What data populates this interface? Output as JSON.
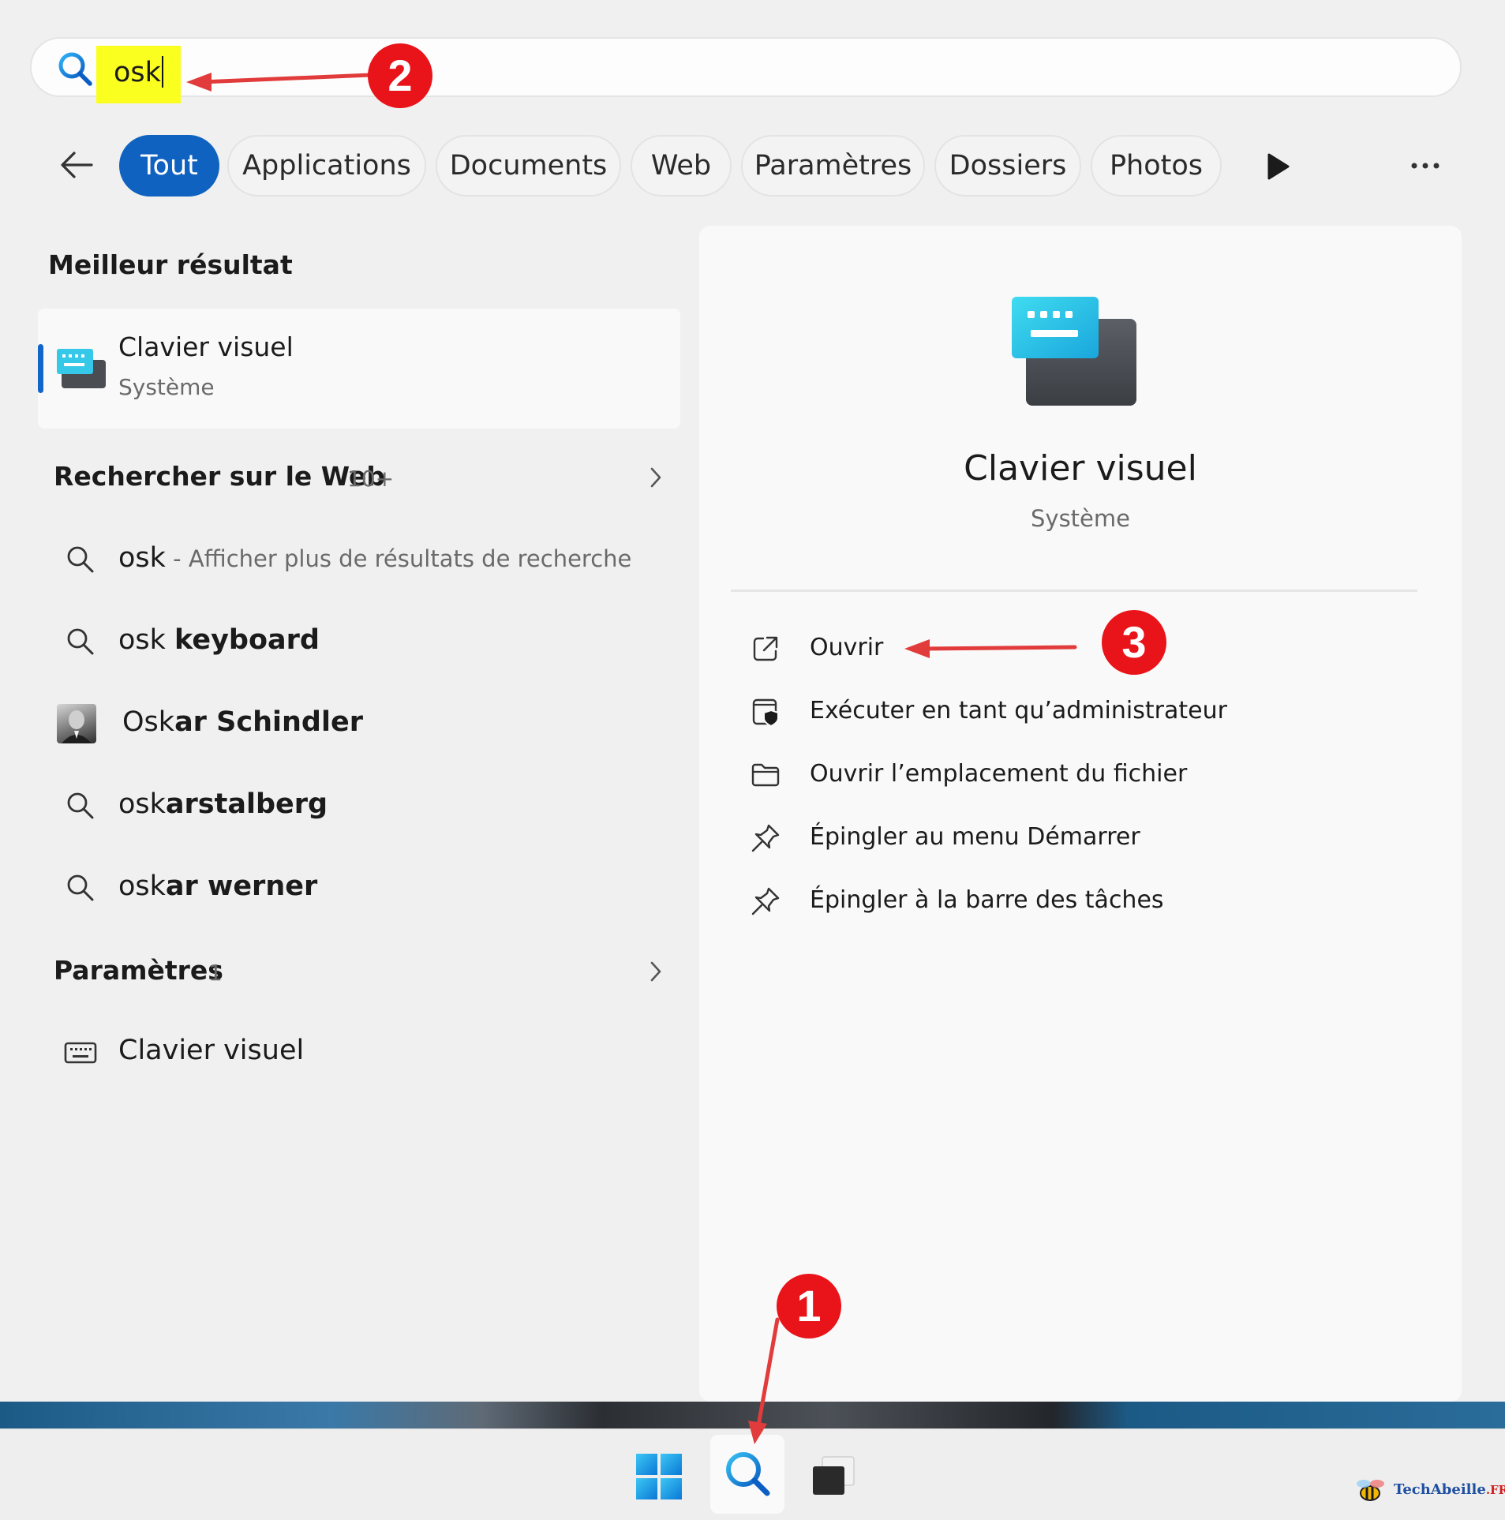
{
  "search": {
    "query": "osk"
  },
  "filters": {
    "tabs": [
      "Tout",
      "Applications",
      "Documents",
      "Web",
      "Paramètres",
      "Dossiers",
      "Photos"
    ],
    "active": "Tout"
  },
  "left": {
    "best_heading": "Meilleur résultat",
    "best": {
      "title": "Clavier visuel",
      "subtitle": "Système"
    },
    "web_heading": "Rechercher sur le Web",
    "web_count": "10+",
    "web_results": [
      {
        "icon": "search-icon",
        "prefix": "osk",
        "bold": "",
        "hint": " - Afficher plus de résultats de recherche"
      },
      {
        "icon": "search-icon",
        "prefix": "osk ",
        "bold": "keyboard",
        "hint": ""
      },
      {
        "icon": "person-photo",
        "prefix": "Osk",
        "bold": "ar Schindler",
        "hint": ""
      },
      {
        "icon": "search-icon",
        "prefix": "osk",
        "bold": "arstalberg",
        "hint": ""
      },
      {
        "icon": "search-icon",
        "prefix": "osk",
        "bold": "ar werner",
        "hint": ""
      }
    ],
    "settings_heading": "Paramètres",
    "settings_count": "1",
    "settings_results": [
      {
        "icon": "keyboard-icon",
        "label": "Clavier visuel"
      }
    ]
  },
  "right": {
    "title": "Clavier visuel",
    "subtitle": "Système",
    "actions": [
      {
        "icon": "open-external-icon",
        "label": "Ouvrir"
      },
      {
        "icon": "admin-shield-icon",
        "label": "Exécuter en tant qu’administrateur"
      },
      {
        "icon": "folder-icon",
        "label": "Ouvrir l’emplacement du fichier"
      },
      {
        "icon": "pin-icon",
        "label": "Épingler au menu Démarrer"
      },
      {
        "icon": "pin-icon",
        "label": "Épingler à la barre des tâches"
      }
    ]
  },
  "annotations": {
    "badge1": "1",
    "badge2": "2",
    "badge3": "3"
  },
  "watermark": {
    "name": "TechAbeille",
    "tld": ".FR"
  },
  "colors": {
    "accent": "#1062c1",
    "highlight": "#fbff1f",
    "annotation": "#e8141a"
  }
}
